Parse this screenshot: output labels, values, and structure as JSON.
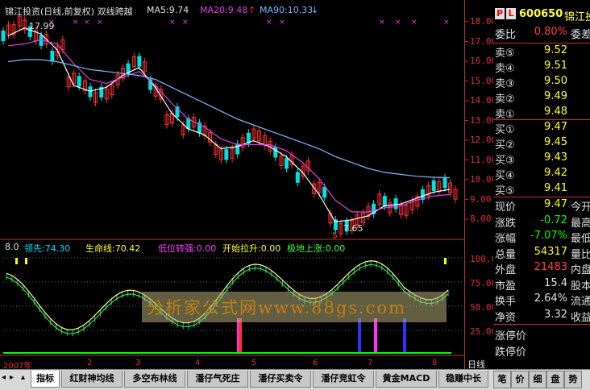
{
  "header": {
    "title": "锦江投资(日线,前复权) 双线跨越",
    "ma5_label": "MA5:9.74",
    "ma20_label": "MA20:9.48",
    "ma90_label": "MA90:10.33",
    "high_marker": "17.99",
    "low_marker": "7.65"
  },
  "indicator": {
    "scale_top": "8.0",
    "lead_label": "领先:74.30",
    "life_label": "生命线:70.42",
    "low_strong_label": "低位转强:0.00",
    "start_pull_label": "开始拉升:0.00",
    "bottom_rise_label": "极地上涨:0.00"
  },
  "y_axis_price": [
    "18.00",
    "17.00",
    "16.00",
    "15.00",
    "14.00",
    "13.00",
    "12.00",
    "11.00",
    "10.00",
    "9.00",
    "8.00"
  ],
  "y_axis_indicator": [
    "100.0",
    "75.00",
    "50.00",
    "25.00"
  ],
  "x_axis": [
    "2007年",
    "2",
    "3",
    "4",
    "5",
    "6",
    "7",
    "8"
  ],
  "period_label": "日线",
  "watermark": "分析家公式网www.88gs.com",
  "quote": {
    "badge_p": "P",
    "badge_l": "L",
    "code": "600650",
    "name": "锦江投",
    "weibi_label": "委比",
    "weibi_value": "0.80%",
    "weibi_extra": "委差",
    "asks": [
      {
        "label": "卖⑤",
        "price": "9.52"
      },
      {
        "label": "卖④",
        "price": "9.51"
      },
      {
        "label": "卖③",
        "price": "9.50"
      },
      {
        "label": "卖②",
        "price": "9.49"
      },
      {
        "label": "卖①",
        "price": "9.48"
      }
    ],
    "bids": [
      {
        "label": "买①",
        "price": "9.47"
      },
      {
        "label": "买②",
        "price": "9.45"
      },
      {
        "label": "买③",
        "price": "9.43"
      },
      {
        "label": "买④",
        "price": "9.42"
      },
      {
        "label": "买⑤",
        "price": "9.41"
      }
    ],
    "stats": [
      {
        "label": "现价",
        "value": "9.47",
        "extra": "今开",
        "color": "#ffff00"
      },
      {
        "label": "涨跌",
        "value": "-0.72",
        "extra": "最高",
        "color": "#00ff00"
      },
      {
        "label": "涨幅",
        "value": "-7.07%",
        "extra": "最低",
        "color": "#00ff00"
      },
      {
        "label": "总量",
        "value": "54317",
        "extra": "量比",
        "color": "#ffff00"
      },
      {
        "label": "外盘",
        "value": "21483",
        "extra": "内盘",
        "color": "#ff4040"
      },
      {
        "label": "市盈",
        "value": "15.4",
        "extra": "股本",
        "color": "#e0e0e0"
      },
      {
        "label": "换手",
        "value": "2.64%",
        "extra": "流通",
        "color": "#e0e0e0"
      },
      {
        "label": "净资",
        "value": "3.32",
        "extra": "收益",
        "color": "#e0e0e0"
      }
    ],
    "limit_up_label": "涨停价",
    "limit_down_label": "跌停价"
  },
  "tabs": [
    "指标",
    "红财神均线",
    "多空布林线",
    "潘仔气死庄",
    "潘仔买卖令",
    "潘仔竞虹令",
    "黄金MACD",
    "稳赚中长"
  ],
  "right_tabs": [
    "笔",
    "价",
    "细",
    "盘",
    "势"
  ],
  "chart_data": {
    "type": "line",
    "series": [
      {
        "name": "MA5",
        "values": [
          17.5,
          17.9,
          17.6,
          16.8,
          15.0,
          14.7,
          14.9,
          15.5,
          15.9,
          14.9,
          13.6,
          12.8,
          12.5,
          11.8,
          11.9,
          12.2,
          11.9,
          11.4,
          10.6,
          9.5,
          8.1,
          8.2,
          8.4,
          8.9,
          9.0,
          9.3,
          9.6,
          9.74
        ]
      },
      {
        "name": "MA20",
        "values": [
          17.0,
          17.1,
          17.3,
          17.1,
          16.1,
          15.3,
          15.1,
          15.4,
          15.7,
          15.0,
          14.1,
          13.3,
          12.9,
          12.3,
          12.0,
          12.0,
          12.0,
          11.7,
          11.1,
          10.3,
          9.2,
          8.6,
          8.6,
          8.8,
          8.9,
          9.2,
          9.4,
          9.48
        ]
      },
      {
        "name": "MA90",
        "values": [
          16.2,
          16.3,
          16.3,
          16.2,
          16.0,
          15.8,
          15.7,
          15.6,
          15.5,
          15.3,
          14.9,
          14.5,
          14.1,
          13.7,
          13.3,
          13.0,
          12.7,
          12.4,
          12.1,
          11.8,
          11.4,
          11.1,
          10.8,
          10.6,
          10.5,
          10.4,
          10.35,
          10.33
        ]
      }
    ],
    "ylim": [
      7.5,
      18.5
    ]
  }
}
